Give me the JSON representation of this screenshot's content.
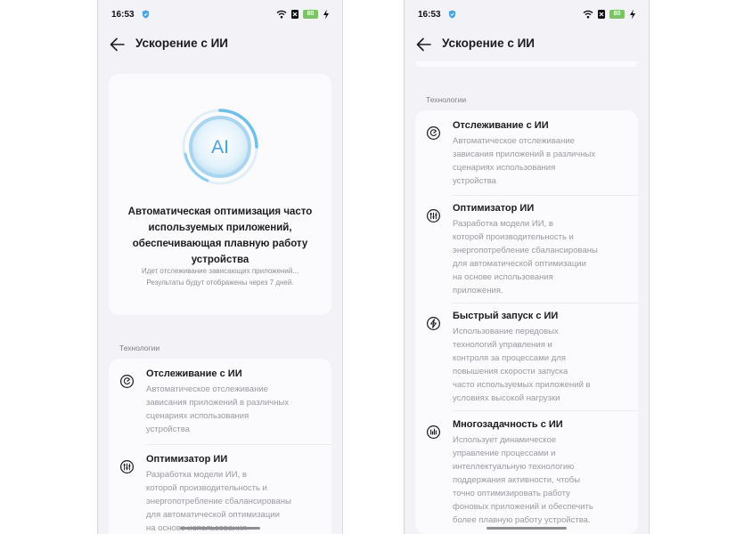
{
  "status_bar": {
    "time": "16:53",
    "battery": "80"
  },
  "header": {
    "title": "Ускорение с ИИ"
  },
  "hero": {
    "badge": "AI",
    "title": "Автоматическая оптимизация часто используемых приложений, обеспечивающая плавную работу устройства",
    "subtitle_line1": "Идет отслеживание зависающих приложений...",
    "subtitle_line2": "Результаты будут отображены через 7 дней."
  },
  "section": {
    "label": "Технологии"
  },
  "technologies": [
    {
      "name": "Отслеживание с ИИ",
      "icon": "ai-monitor-icon",
      "desc_lines": [
        "Автоматическое отслеживание",
        "зависания приложений в различных",
        "сценариях использования",
        "устройства"
      ]
    },
    {
      "name": "Оптимизатор ИИ",
      "icon": "ai-optimizer-icon",
      "desc_lines": [
        "Разработка модели ИИ, в",
        "которой производительность и",
        "энергопотребление сбалансированы",
        "для автоматической оптимизации",
        "на основе использования",
        "приложения."
      ]
    },
    {
      "name": "Быстрый запуск с ИИ",
      "icon": "ai-quick-launch-icon",
      "desc_lines": [
        "Использование передовых",
        "технологий управления и",
        "контроля за процессами для",
        "повышения скорости запуска",
        "часто используемых приложений в",
        "условиях высокой нагрузки"
      ]
    },
    {
      "name": "Многозадачность с ИИ",
      "icon": "ai-multitask-icon",
      "desc_lines": [
        "Использует динамическое",
        "управление процессами и",
        "интеллектуальную технологию",
        "поддержания активности, чтобы",
        "точно оптимизировать работу",
        "фоновых приложений и обеспечить",
        "более плавную работу устройства."
      ]
    }
  ],
  "colors": {
    "background": "#f2f2f7",
    "card": "#fbfbfd",
    "accent_blue": "#4aa3df",
    "battery": "#7ac466"
  }
}
